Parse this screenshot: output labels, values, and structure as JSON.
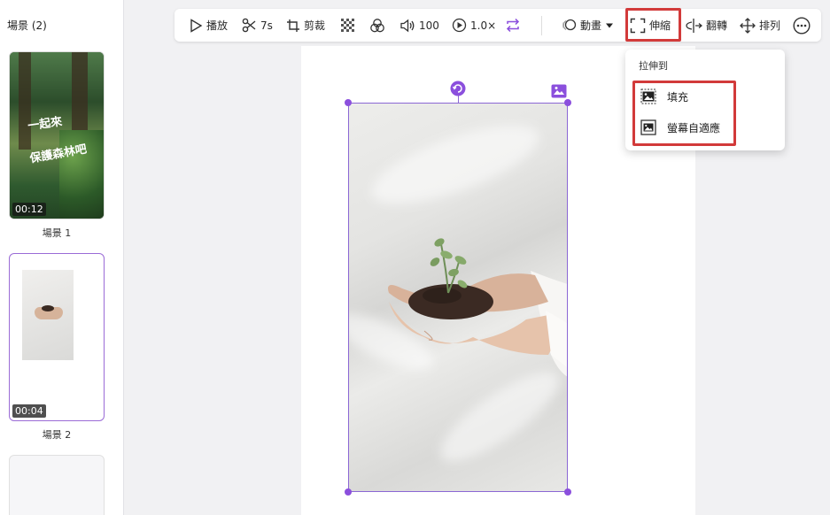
{
  "scenes_panel": {
    "title": "場景 (2)",
    "scenes": [
      {
        "label": "場景 1",
        "duration": "00:12",
        "text_line1": "一起來",
        "text_line2": "保護森林吧"
      },
      {
        "label": "場景 2",
        "duration": "00:04"
      }
    ]
  },
  "toolbar": {
    "play_label": "播放",
    "trim_label": "7s",
    "crop_label": "剪裁",
    "volume_label": "100",
    "speed_label": "1.0×",
    "animate_label": "動畫",
    "stretch_label": "伸縮",
    "flip_label": "翻轉",
    "arrange_label": "排列"
  },
  "stretch_menu": {
    "title": "拉伸到",
    "items": [
      {
        "label": "填充",
        "icon": "image-fill-icon"
      },
      {
        "label": "螢幕自適應",
        "icon": "image-fit-icon"
      }
    ]
  },
  "colors": {
    "accent": "#8b4fdd",
    "highlight": "#d23a3a"
  }
}
